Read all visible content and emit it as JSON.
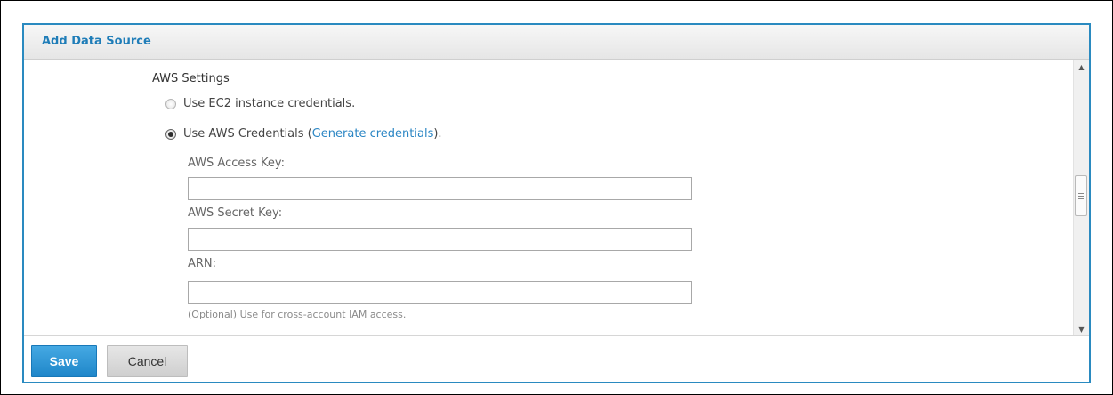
{
  "dialog": {
    "title": "Add Data Source"
  },
  "aws_settings": {
    "heading": "AWS Settings",
    "options": [
      {
        "label": "Use EC2 instance credentials.",
        "selected": false
      },
      {
        "label_prefix": "Use AWS Credentials (",
        "link_text": "Generate credentials",
        "label_suffix": ").",
        "selected": true
      }
    ],
    "fields": {
      "access_key": {
        "label": "AWS Access Key:",
        "value": "",
        "placeholder": ""
      },
      "secret_key": {
        "label": "AWS Secret Key:",
        "value": "",
        "placeholder": ""
      },
      "arn": {
        "label": "ARN:",
        "value": "",
        "placeholder": "",
        "hint": "(Optional) Use for cross-account IAM access."
      }
    }
  },
  "footer": {
    "save_label": "Save",
    "cancel_label": "Cancel"
  },
  "colors": {
    "accent": "#2a8ac0",
    "title_text": "#1f7db8",
    "link": "#2b86c4",
    "save_button": "#2a93d5"
  },
  "icons": {
    "scroll_up": "scroll-up-arrow-icon",
    "scroll_down": "scroll-down-arrow-icon",
    "scroll_grip": "grip-lines-icon"
  }
}
